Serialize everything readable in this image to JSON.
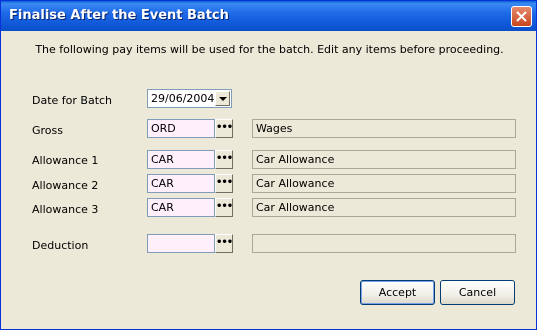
{
  "window": {
    "title": "Finalise After the Event Batch"
  },
  "intro_text": "The following pay items will be used for the batch. Edit any items before proceeding.",
  "date": {
    "label": "Date for Batch",
    "value": "29/06/2004"
  },
  "rows": [
    {
      "label": "Gross",
      "code": "ORD",
      "description": "Wages"
    },
    {
      "label": "Allowance 1",
      "code": "CAR",
      "description": "Car Allowance"
    },
    {
      "label": "Allowance 2",
      "code": "CAR",
      "description": "Car Allowance"
    },
    {
      "label": "Allowance 3",
      "code": "CAR",
      "description": "Car Allowance"
    },
    {
      "label": "Deduction",
      "code": "",
      "description": ""
    }
  ],
  "ellipsis": "•••",
  "buttons": {
    "accept": "Accept",
    "cancel": "Cancel"
  },
  "colors": {
    "titlebar": "#0a5fd8",
    "dialog_bg": "#ece9d8",
    "required_field": "#fff0fc"
  }
}
